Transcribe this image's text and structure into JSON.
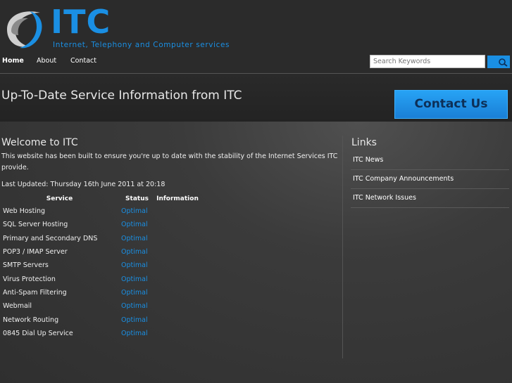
{
  "brand": {
    "name": "ITC",
    "tagline": "Internet, Telephony and Computer services",
    "accent": "#1a8fe3"
  },
  "nav": {
    "items": [
      {
        "label": "Home",
        "active": true
      },
      {
        "label": "About",
        "active": false
      },
      {
        "label": "Contact",
        "active": false
      }
    ]
  },
  "search": {
    "placeholder": "Search Keywords",
    "button_icon": "search-icon"
  },
  "banner": {
    "title": "Up-To-Date Service Information from ITC",
    "contact_button": "Contact Us"
  },
  "main": {
    "title": "Welcome to ITC",
    "intro": "This website has been built to ensure you're up to date with the stability of the Internet Services ITC provide.",
    "last_updated": "Last Updated: Thursday 16th June 2011 at 20:18",
    "table": {
      "headers": [
        "Service",
        "Status",
        "Information"
      ],
      "rows": [
        {
          "service": "Web Hosting",
          "status": "Optimal",
          "info": ""
        },
        {
          "service": "SQL Server Hosting",
          "status": "Optimal",
          "info": ""
        },
        {
          "service": "Primary and Secondary DNS",
          "status": "Optimal",
          "info": ""
        },
        {
          "service": "POP3 / IMAP Server",
          "status": "Optimal",
          "info": ""
        },
        {
          "service": "SMTP Servers",
          "status": "Optimal",
          "info": ""
        },
        {
          "service": "Virus Protection",
          "status": "Optimal",
          "info": ""
        },
        {
          "service": "Anti-Spam Filtering",
          "status": "Optimal",
          "info": ""
        },
        {
          "service": "Webmail",
          "status": "Optimal",
          "info": ""
        },
        {
          "service": "Network Routing",
          "status": "Optimal",
          "info": ""
        },
        {
          "service": "0845 Dial Up Service",
          "status": "Optimal",
          "info": ""
        }
      ]
    }
  },
  "sidebar": {
    "title": "Links",
    "items": [
      {
        "label": "ITC News"
      },
      {
        "label": "ITC Company Announcements"
      },
      {
        "label": "ITC Network Issues"
      }
    ]
  }
}
